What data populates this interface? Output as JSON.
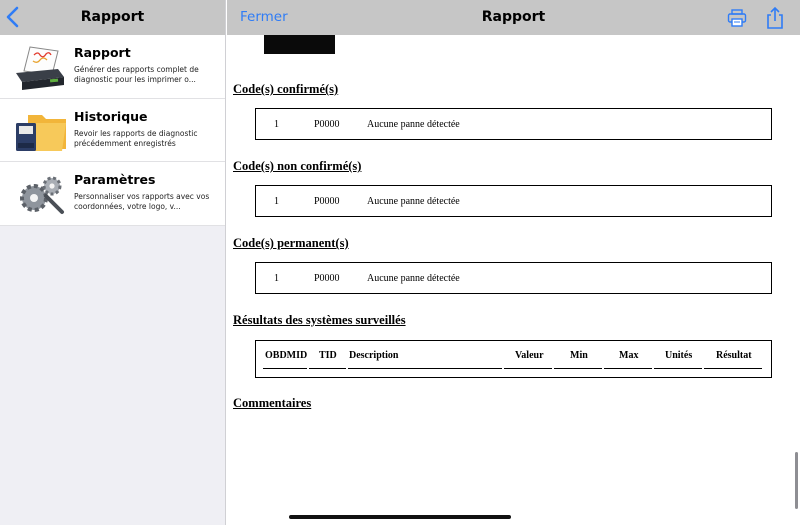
{
  "sidebar": {
    "title": "Rapport",
    "back_icon": "chevron-left-icon",
    "items": [
      {
        "title": "Rapport",
        "description": "Générer des rapports complet de diagnostic pour les imprimer o...",
        "icon": "printer-report-icon"
      },
      {
        "title": "Historique",
        "description": "Revoir les rapports de diagnostic précédemment enregistrés",
        "icon": "folder-sdcard-icon"
      },
      {
        "title": "Paramètres",
        "description": "Personnaliser vos rapports avec vos coordonnées, votre logo, v...",
        "icon": "gears-icon"
      }
    ]
  },
  "main": {
    "close_label": "Fermer",
    "title": "Rapport",
    "accent_color": "#2f7cf6",
    "print_icon": "printer-icon",
    "share_icon": "share-icon"
  },
  "report": {
    "confirmed": {
      "title": "Code(s) confirmé(s)",
      "index": "1",
      "code": "P0000",
      "description": "Aucune panne détectée"
    },
    "unconfirmed": {
      "title": "Code(s) non confirmé(s)",
      "index": "1",
      "code": "P0000",
      "description": "Aucune panne détectée"
    },
    "permanent": {
      "title": "Code(s) permanent(s)",
      "index": "1",
      "code": "P0000",
      "description": "Aucune panne détectée"
    },
    "monitors": {
      "title": "Résultats des systèmes surveillés",
      "columns": [
        "OBDMID",
        "TID",
        "Description",
        "Valeur",
        "Min",
        "Max",
        "Unités",
        "Résultat"
      ]
    },
    "comments": {
      "title": "Commentaires"
    }
  }
}
